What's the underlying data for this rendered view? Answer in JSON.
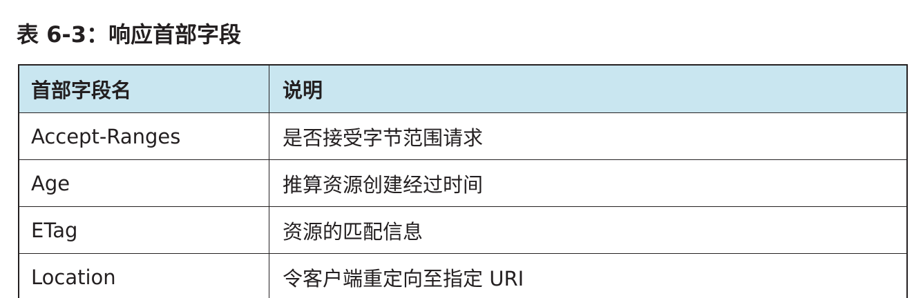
{
  "caption": "表 6-3：响应首部字段",
  "table": {
    "headers": [
      "首部字段名",
      "说明"
    ],
    "rows": [
      [
        "Accept-Ranges",
        "是否接受字节范围请求"
      ],
      [
        "Age",
        "推算资源创建经过时间"
      ],
      [
        "ETag",
        "资源的匹配信息"
      ],
      [
        "Location",
        "令客户端重定向至指定 URI"
      ]
    ]
  },
  "colors": {
    "header_background": "#c9e6f0",
    "border": "#231f20",
    "text": "#231f20"
  }
}
